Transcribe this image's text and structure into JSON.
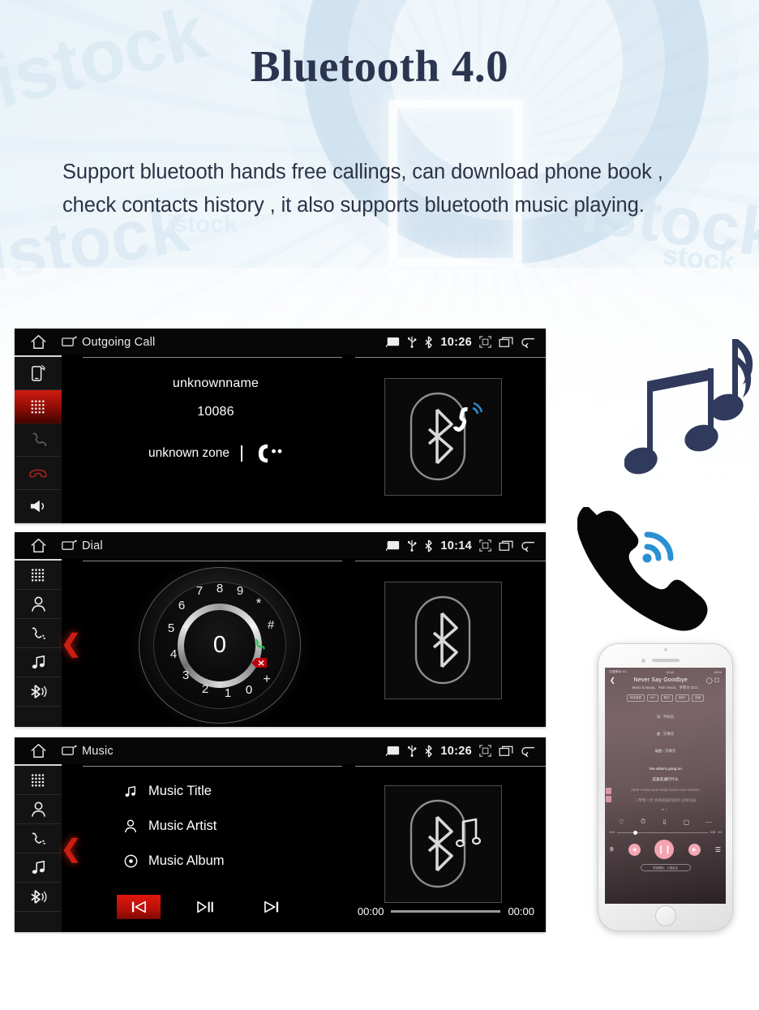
{
  "page": {
    "title": "Bluetooth 4.0",
    "description": "Support bluetooth hands free callings, can download phone book , check contacts history , it also supports bluetooth music playing.",
    "background_watermarks": [
      "istock",
      "istock",
      "istock",
      "stock",
      "istock"
    ],
    "accent_red": "#cf1b10",
    "title_color": "#2c3550",
    "screen_bg": "#000000"
  },
  "screens": [
    {
      "id": "outgoing-call",
      "source_title": "Outgoing Call",
      "clock": "10:26",
      "status_icons": [
        "cast-icon",
        "usb-icon",
        "bluetooth-icon",
        "fullscreen-icon",
        "recent-apps-icon",
        "back-icon"
      ],
      "sidebar": [
        {
          "name": "phone-connect-icon",
          "active": false
        },
        {
          "name": "keypad-icon",
          "active": true
        },
        {
          "name": "answer-call-icon",
          "active": false
        },
        {
          "name": "end-call-icon",
          "active": false
        },
        {
          "name": "speaker-icon",
          "active": false
        }
      ],
      "call": {
        "name": "unknownname",
        "number": "10086",
        "zone": "unknown zone",
        "status_icon": "calling-icon"
      },
      "art": "bluetooth-call-icon"
    },
    {
      "id": "dial",
      "source_title": "Dial",
      "clock": "10:14",
      "status_icons": [
        "cast-icon",
        "usb-icon",
        "bluetooth-icon",
        "fullscreen-icon",
        "recent-apps-icon",
        "back-icon"
      ],
      "sidebar": [
        {
          "name": "keypad-icon",
          "active": false
        },
        {
          "name": "contacts-icon",
          "active": false
        },
        {
          "name": "call-history-icon",
          "active": false
        },
        {
          "name": "music-icon",
          "active": false
        },
        {
          "name": "bluetooth-icon",
          "active": false
        }
      ],
      "dial": {
        "center_value": "0",
        "keys": [
          "1",
          "2",
          "3",
          "4",
          "5",
          "6",
          "7",
          "8",
          "9",
          "*",
          "#"
        ],
        "selected_key": "0",
        "extra_keys": [
          "+"
        ],
        "call_button": "answer-call-icon",
        "delete_button": "backspace-icon"
      },
      "art": "bluetooth-icon-art"
    },
    {
      "id": "music",
      "source_title": "Music",
      "clock": "10:26",
      "status_icons": [
        "cast-icon",
        "usb-icon",
        "bluetooth-icon",
        "fullscreen-icon",
        "recent-apps-icon",
        "back-icon"
      ],
      "sidebar": [
        {
          "name": "keypad-icon",
          "active": false
        },
        {
          "name": "contacts-icon",
          "active": false
        },
        {
          "name": "call-history-icon",
          "active": false
        },
        {
          "name": "music-icon",
          "active": false
        },
        {
          "name": "bluetooth-icon",
          "active": false
        }
      ],
      "list": [
        {
          "icon": "music-note-icon",
          "label": "Music Title"
        },
        {
          "icon": "person-icon",
          "label": "Music Artist"
        },
        {
          "icon": "disc-icon",
          "label": "Music Album"
        }
      ],
      "controls": [
        {
          "name": "previous-track-button",
          "glyph": "prev",
          "active": true
        },
        {
          "name": "play-pause-button",
          "glyph": "playpause",
          "active": false
        },
        {
          "name": "next-track-button",
          "glyph": "next",
          "active": false
        }
      ],
      "progress": {
        "elapsed": "00:00",
        "total": "00:00",
        "percent": 0
      },
      "art": "bluetooth-music-icon"
    }
  ],
  "decor": {
    "music_notes": "music-notes-illustration",
    "phone_wifi": "phone-handset-wifi-illustration"
  },
  "iphone": {
    "status_left": "中国移动 4G",
    "status_center": "16:40",
    "status_right": "100%",
    "song_title": "Never Say Goodbye",
    "song_subtitle": "Mario & Nasty、Park Sinon、罗寒文 DCC",
    "chips": [
      "标准音质",
      "MV",
      "歌词",
      "音效+",
      "倍速"
    ],
    "credits": [
      "词 : 不知名",
      "曲 : 交琳音",
      "编曲 : 交琳音"
    ],
    "lyric_active": "Yea what's going on",
    "lyric_active2": "这里名通行什么",
    "lyric_dim": "2008 marks and ready brand new release",
    "lyric_dim2": "二零零八年 风雨来临的新的 这样往返",
    "elapsed": "0:05",
    "total": "3:58",
    "quality_badge": "3/4",
    "bottom_badge": "评论精彩、上相名点"
  }
}
